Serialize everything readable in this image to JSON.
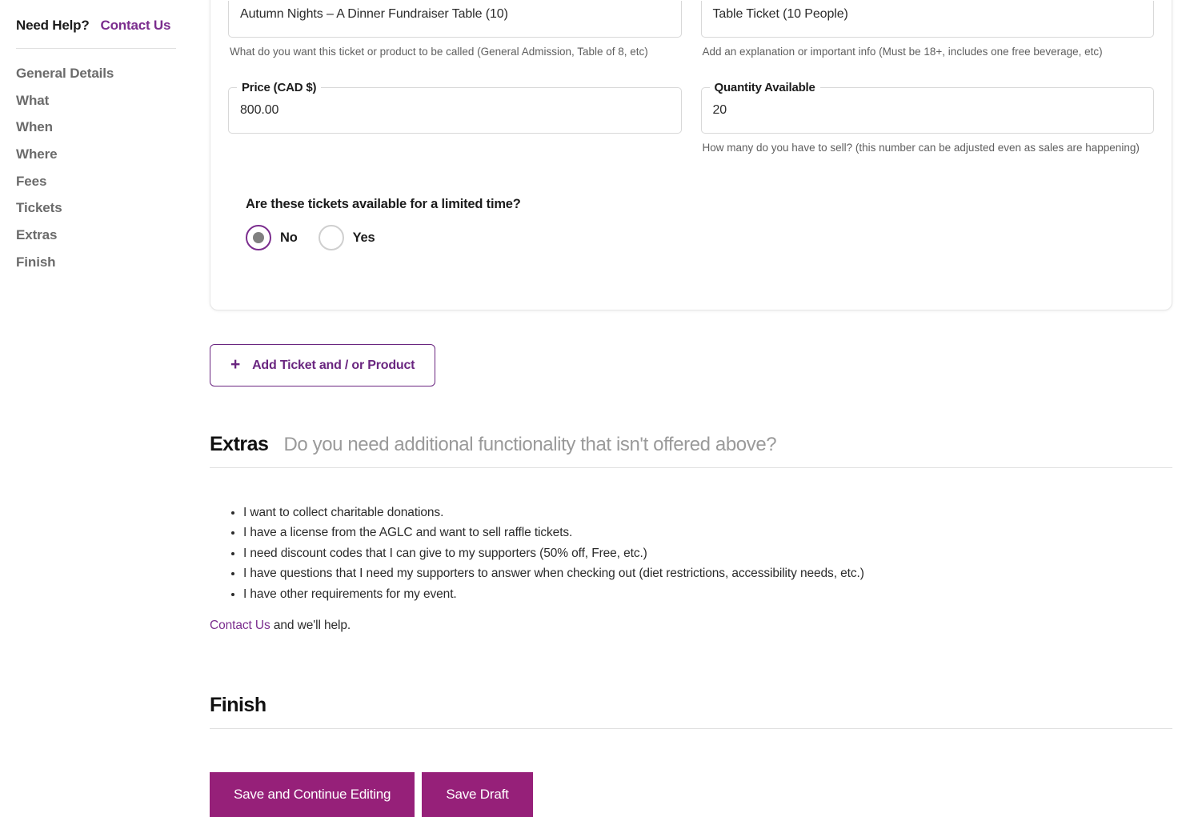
{
  "sidebar": {
    "help_label": "Need Help?",
    "help_link": "Contact Us",
    "items": [
      {
        "label": "General Details"
      },
      {
        "label": "What"
      },
      {
        "label": "When"
      },
      {
        "label": "Where"
      },
      {
        "label": "Fees"
      },
      {
        "label": "Tickets"
      },
      {
        "label": "Extras"
      },
      {
        "label": "Finish"
      }
    ]
  },
  "ticket_card": {
    "name_field": {
      "value": "Autumn Nights – A Dinner Fundraiser Table (10)",
      "helper": "What do you want this ticket or product to be called (General Admission, Table of 8, etc)"
    },
    "description_field": {
      "value": "Table Ticket (10 People)",
      "helper": "Add an explanation or important info (Must be 18+, includes one free beverage, etc)"
    },
    "price_field": {
      "legend": "Price (CAD $)",
      "value": "800.00"
    },
    "quantity_field": {
      "legend": "Quantity Available",
      "value": "20",
      "helper": "How many do you have to sell? (this number can be adjusted even as sales are happening)"
    },
    "limited_time": {
      "question": "Are these tickets available for a limited time?",
      "options": [
        {
          "label": "No",
          "selected": true
        },
        {
          "label": "Yes",
          "selected": false
        }
      ]
    }
  },
  "add_ticket_button": {
    "icon": "plus-icon",
    "glyph": "+",
    "label": "Add Ticket and / or Product"
  },
  "extras": {
    "title": "Extras",
    "subtitle": "Do you need additional functionality that isn't offered above?",
    "items": [
      "I want to collect charitable donations.",
      "I have a license from the AGLC and want to sell raffle tickets.",
      "I need discount codes that I can give to my supporters (50% off, Free, etc.)",
      "I have questions that I need my supporters to answer when checking out (diet restrictions, accessibility needs, etc.)",
      "I have other requirements for my event."
    ],
    "contact_link": "Contact Us",
    "contact_tail": " and we'll help."
  },
  "finish": {
    "title": "Finish",
    "save_continue_label": "Save and Continue Editing",
    "save_draft_label": "Save Draft"
  },
  "colors": {
    "purple": "#7B2D8E",
    "magenta": "#962079",
    "muted_text": "#6B6B6B",
    "divider": "#E0E0E0"
  }
}
